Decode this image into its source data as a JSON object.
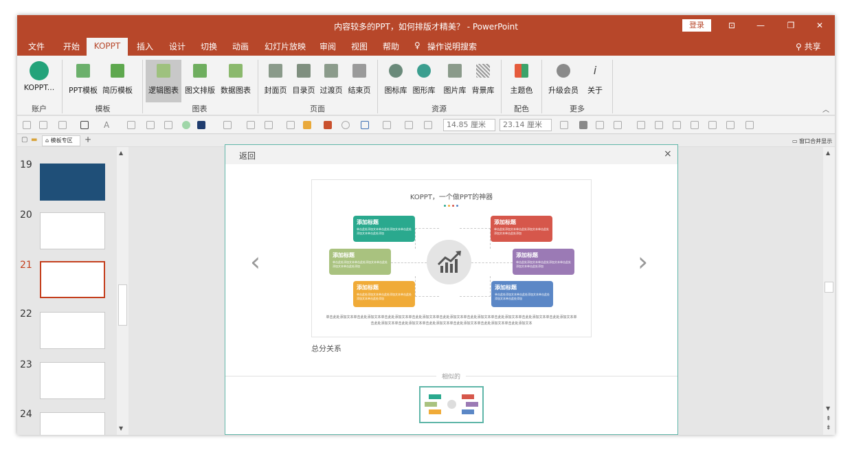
{
  "window": {
    "title": "内容较多的PPT，如何排版才精美？  -  PowerPoint",
    "login_label": "登录",
    "share_label": "共享"
  },
  "tabs": [
    "文件",
    "开始",
    "KOPPT",
    "插入",
    "设计",
    "切换",
    "动画",
    "幻灯片放映",
    "审阅",
    "视图",
    "帮助",
    "操作说明搜索"
  ],
  "ribbon": {
    "account": {
      "button": "KOPPT...",
      "group": "账户"
    },
    "template": {
      "buttons": [
        "PPT模板",
        "简历模板"
      ],
      "group": "模板"
    },
    "chart": {
      "buttons": [
        "逻辑图表",
        "图文排版",
        "数据图表"
      ],
      "group": "图表"
    },
    "page": {
      "buttons": [
        "封面页",
        "目录页",
        "过渡页",
        "结束页"
      ],
      "group": "页面"
    },
    "resource": {
      "buttons": [
        "图标库",
        "图形库",
        "图片库",
        "背景库"
      ],
      "group": "资源"
    },
    "color": {
      "buttons": [
        "主题色"
      ],
      "group": "配色"
    },
    "more": {
      "buttons": [
        "升级会员",
        "关于"
      ],
      "group": "更多"
    }
  },
  "toolbar": {
    "width_value": "14.85 厘米",
    "height_value": "23.14 厘米"
  },
  "thumbbar": {
    "template_tab": "模板专区",
    "merge_label": "窗口合并显示"
  },
  "slides_panel": {
    "numbers": [
      "19",
      "20",
      "21",
      "22",
      "23",
      "24"
    ],
    "selected": "21"
  },
  "dialog": {
    "back_label": "返回",
    "close_label": "×",
    "slide_title": "KOPPT，一个做PPT的神器",
    "cards": [
      {
        "title": "添加标题",
        "body": "单击此处添加文本单击此处添加文本单击此处添加文本单击此处添加",
        "color": "#2aa98e"
      },
      {
        "title": "添加标题",
        "body": "单击此处添加文本单击此处添加文本单击此处添加文本单击此处添加",
        "color": "#d6574b"
      },
      {
        "title": "添加标题",
        "body": "单击此处添加文本单击此处添加文本单击此处添加文本单击此处添加",
        "color": "#a9c27f"
      },
      {
        "title": "添加标题",
        "body": "单击此处添加文本单击此处添加文本单击此处添加文本单击此处添加",
        "color": "#9b7ab5"
      },
      {
        "title": "添加标题",
        "body": "单击此处添加文本单击此处添加文本单击此处添加文本单击此处添加",
        "color": "#f0ab38"
      },
      {
        "title": "添加标题",
        "body": "单击此处添加文本单击此处添加文本单击此处添加文本单击此处添加",
        "color": "#5b87c6"
      }
    ],
    "footer_text": "单击此处添加文本单击此处添加文本单击此处添加文本单击此处添加文本单击此处添加文本单击此处添加文本单击此处添加文本单击此处添加文本单击此处添加文本单击此处添加文本单击此处添加文本单击此处添加文本单击此处添加文本单击此处添加文本单击此处添加文本",
    "caption": "总分关系",
    "similar_label": "相似的",
    "dots": [
      "#2aa98e",
      "#f0ab38",
      "#d6574b",
      "#5b87c6"
    ]
  },
  "colors": {
    "accent": "#b7472a",
    "dialog_border": "#5fb6a8"
  }
}
